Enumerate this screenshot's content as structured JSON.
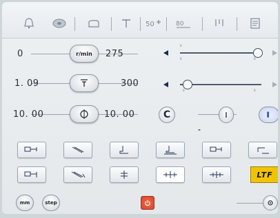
{
  "speed": {
    "value": "0",
    "max": "275",
    "unit": "r/min"
  },
  "feed": {
    "value": "1. 09",
    "max": "300"
  },
  "thread": {
    "left": "10. 00",
    "right": "10. 00"
  },
  "sliders": {
    "top": {
      "left_tick": "0",
      "right_tick": "0"
    },
    "mid": {
      "left_tick": "0",
      "right_tick": "0"
    }
  },
  "reset_button": "C",
  "brand_logo": "LTF",
  "bottom": {
    "mm": "mm",
    "step": "step"
  },
  "colors": {
    "accent": "#1b2a55",
    "power": "#d6452b",
    "logo": "#f2c400"
  }
}
